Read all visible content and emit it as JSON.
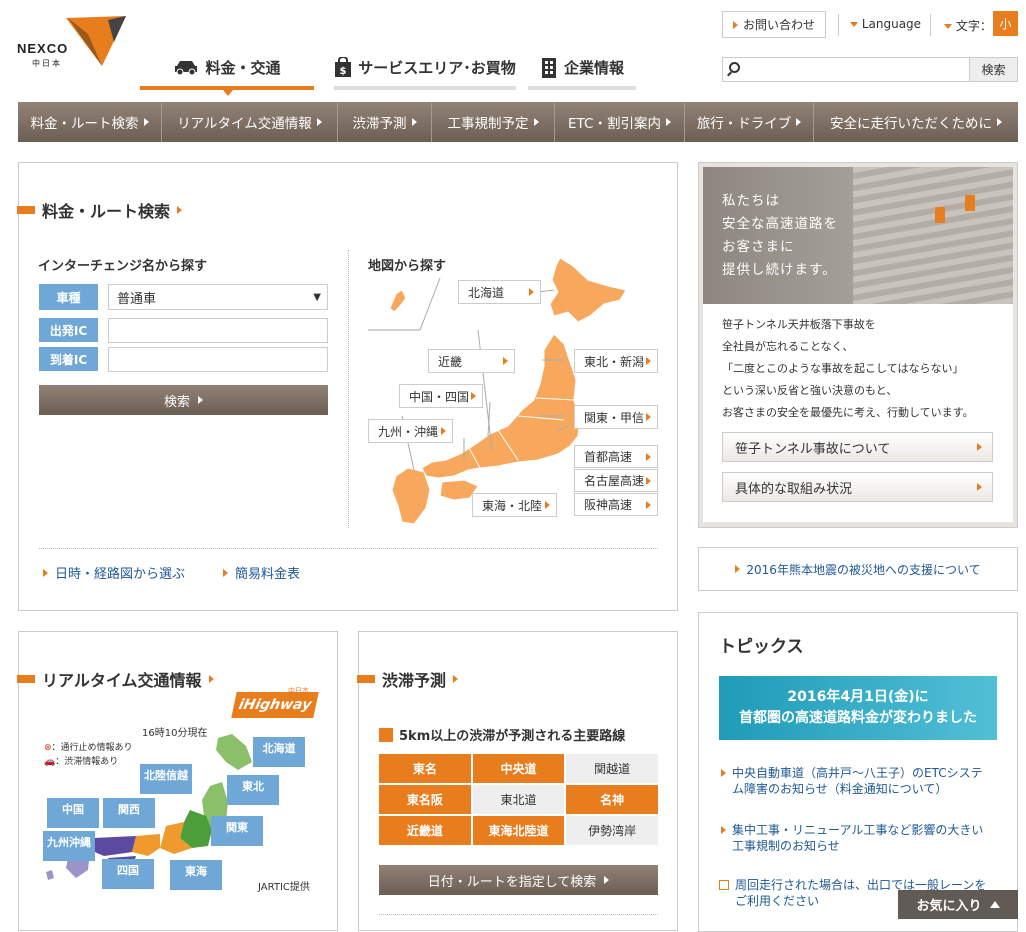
{
  "header": {
    "logo_text": "NEXCO",
    "logo_sub": "中日本",
    "global_tabs": [
      {
        "label": "料金・交通",
        "icon": "car-icon"
      },
      {
        "label": "サービスエリア･お買物",
        "icon": "shopping-bag-icon"
      },
      {
        "label": "企業情報",
        "icon": "building-icon"
      }
    ],
    "inquiry": "お問い合わせ",
    "language": "Language",
    "font_size_label": "文字：",
    "font_size_btn": "小",
    "search_button": "検索",
    "search_value": ""
  },
  "nav": [
    "料金・ルート検索",
    "リアルタイム交通情報",
    "渋滞予測",
    "工事規制予定",
    "ETC・割引案内",
    "旅行・ドライブ",
    "安全に走行いただくために"
  ],
  "fare": {
    "title": "料金・ルート検索",
    "ic_heading": "インターチェンジ名から探す",
    "vehicle_label": "車種",
    "vehicle_value": "普通車",
    "depart_label": "出発IC",
    "arrive_label": "到着IC",
    "search_button": "検索",
    "map_heading": "地図から探す",
    "regions": [
      "北海道",
      "東北・新潟",
      "近畿",
      "中国・四国",
      "関東・甲信",
      "九州・沖縄",
      "首都高速",
      "名古屋高速",
      "阪神高速",
      "東海・北陸"
    ],
    "links": [
      "日時・経路図から選ぶ",
      "簡易料金表"
    ]
  },
  "promo": {
    "headline": [
      "私たちは",
      "安全な高速道路を",
      "お客さまに",
      "提供し続けます。"
    ],
    "body": [
      "笹子トンネル天井板落下事故を",
      "全社員が忘れることなく、",
      "「二度とこのような事故を起こしてはならない」",
      "という深い反省と強い決意のもと、",
      "お客さまの安全を最優先に考え、行動しています。"
    ],
    "buttons": [
      "笹子トンネル事故について",
      "具体的な取組み状況"
    ]
  },
  "quake_link": "2016年熊本地震の被災地への支援について",
  "traffic": {
    "title": "リアルタイム交通情報",
    "badge": "iHighway",
    "badge_sub": "中日本",
    "timestamp": "16時10分現在",
    "legend": [
      "：通行止め情報あり",
      "：渋滞情報あり"
    ],
    "regions": [
      "北海道",
      "北陸信越",
      "東北",
      "中国",
      "関西",
      "関東",
      "九州沖縄",
      "四国",
      "東海"
    ],
    "credit": "JARTIC提供"
  },
  "jam": {
    "title": "渋滞予測",
    "subheading": "5km以上の渋滞が予測される主要路線",
    "routes": [
      [
        "東名",
        "中央道",
        "関越道"
      ],
      [
        "東名阪",
        "東北道",
        "名神"
      ],
      [
        "近畿道",
        "東海北陸道",
        "伊勢湾岸"
      ]
    ],
    "search_button": "日付・ルートを指定して検索"
  },
  "topics": {
    "title": "トピックス",
    "banner": [
      "2016年4月1日(金)に",
      "首都圏の高速道路料金が変わりました"
    ],
    "items": [
      "中央自動車道（高井戸～八王子）のETCシステム障害のお知らせ（料金通知について）",
      "集中工事・リニューアル工事など影響の大きい工事規制のお知らせ",
      "周回走行された場合は、出口では一般レーンをご利用ください"
    ]
  },
  "favorite": "お気に入り",
  "colors": {
    "accent": "#e87d1e",
    "nav": "#7a6d62",
    "label_blue": "#6fa8d6",
    "link": "#1f5896"
  }
}
